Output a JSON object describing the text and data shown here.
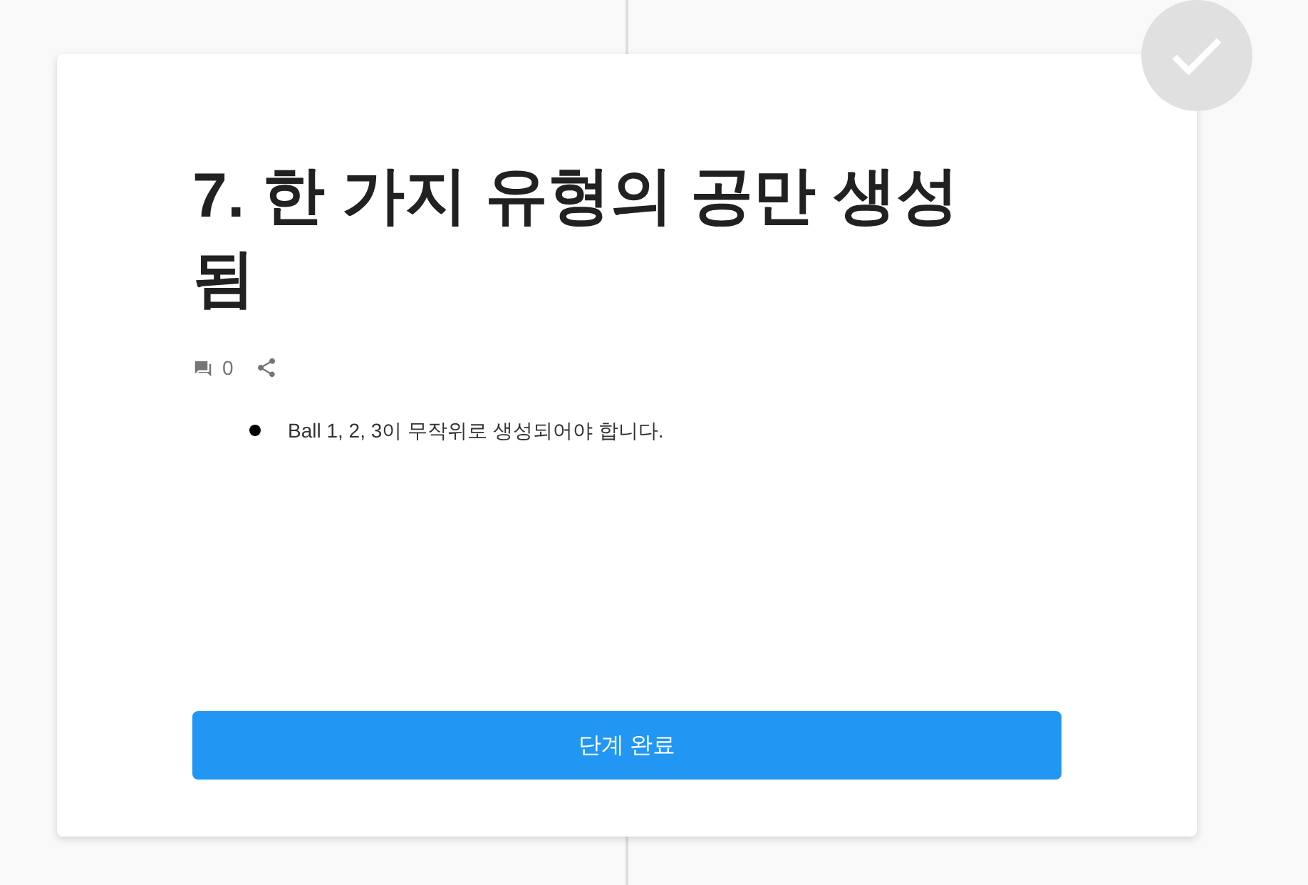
{
  "step": {
    "title": "7. 한 가지 유형의 공만 생성 됨",
    "completed": false,
    "comment_count": "0",
    "bullets": [
      "Ball 1, 2, 3이 무작위로 생성되어야 합니다."
    ],
    "complete_button": "단계 완료"
  }
}
